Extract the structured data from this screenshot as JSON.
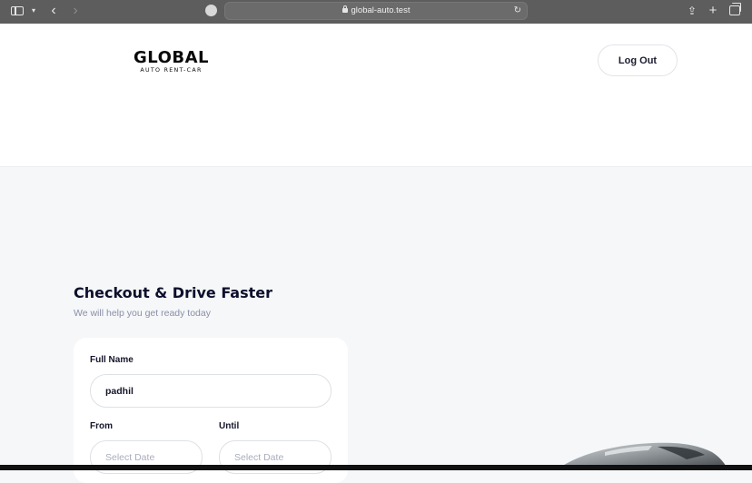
{
  "browser": {
    "url": "global-auto.test",
    "icons": {
      "sidebar": "sidebar-icon",
      "caret": "chevron-down-icon",
      "back": "chevron-left-icon",
      "forward": "chevron-right-icon",
      "reload": "reload-icon",
      "share": "share-icon",
      "new_tab": "plus-icon",
      "tabs": "tabs-icon"
    }
  },
  "header": {
    "logo_main": "GLOBAL",
    "logo_sub": "AUTO RENT-CAR",
    "logout_label": "Log Out"
  },
  "main": {
    "title": "Checkout & Drive Faster",
    "subtitle": "We will help you get ready today",
    "form": {
      "full_name_label": "Full Name",
      "full_name_value": "padhil",
      "from_label": "From",
      "from_placeholder": "Select Date",
      "until_label": "Until",
      "until_placeholder": "Select Date"
    }
  },
  "colors": {
    "page_background": "#f5f7f8",
    "header_background": "#ffffff",
    "title": "#0d0f2c",
    "subtitle": "#8b8fa8",
    "field_border": "#dde1e6"
  }
}
